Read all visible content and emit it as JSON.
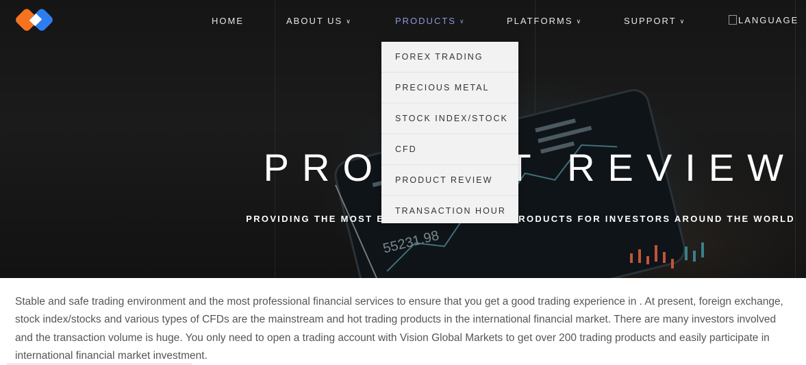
{
  "nav": {
    "items": [
      {
        "label": "HOME",
        "chevron": false
      },
      {
        "label": "ABOUT US",
        "chevron": true
      },
      {
        "label": "PRODUCTS",
        "chevron": true,
        "active": true
      },
      {
        "label": "PLATFORMS",
        "chevron": true
      },
      {
        "label": "SUPPORT",
        "chevron": true
      }
    ],
    "language_label": "LANGUAGE"
  },
  "products_menu": [
    "FOREX TRADING",
    "PRECIOUS METAL",
    "STOCK INDEX/STOCK",
    "CFD",
    "PRODUCT REVIEW",
    "TRANSACTION HOUR"
  ],
  "hero": {
    "title": "PRODUCT REVIEW",
    "subtitle": "PROVIDING THE MOST EXTENSIVE FINANCIAL PRODUCTS FOR INVESTORS AROUND THE WORLD",
    "ticker_text": "55231.98"
  },
  "intro": "Stable and safe trading environment and the most professional financial services to ensure that you get a good trading experience in . At present, foreign exchange, stock index/stocks and various types of CFDs are the mainstream and hot trading products in the international financial market. There are many investors involved and the transaction volume is huge. You only need to open a trading account with Vision Global Markets to get over 200 trading products and easily participate in international financial market investment.",
  "colors": {
    "hero_bg": "#151515",
    "nav_active": "#8a9ad8",
    "dropdown_bg": "#f2f2f2",
    "logo_orange": "#f5731f",
    "logo_blue": "#2d7df0"
  }
}
